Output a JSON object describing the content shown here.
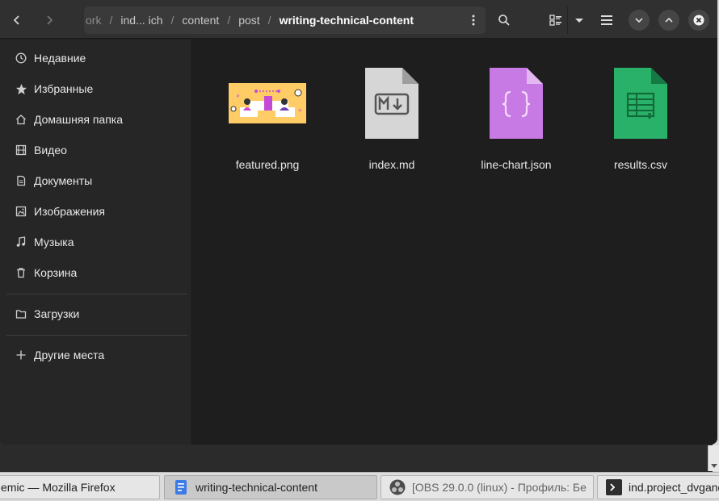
{
  "window": {
    "path": {
      "crumbs": [
        {
          "label": "ork",
          "truncated": true
        },
        {
          "label": "ind... ich"
        },
        {
          "label": "content"
        },
        {
          "label": "post"
        },
        {
          "label": "writing-technical-content",
          "current": true
        }
      ],
      "separator": "/"
    },
    "header_icons": [
      "back-icon",
      "forward-icon",
      "path-menu-icon",
      "search-icon",
      "view-toggle-icon",
      "view-dropdown-icon",
      "main-menu-icon",
      "minimize-icon",
      "maximize-icon",
      "close-icon"
    ]
  },
  "sidebar": {
    "items": [
      {
        "label": "Недавние",
        "icon": "clock-icon"
      },
      {
        "label": "Избранные",
        "icon": "star-icon"
      },
      {
        "label": "Домашняя папка",
        "icon": "home-icon"
      },
      {
        "label": "Видео",
        "icon": "video-icon"
      },
      {
        "label": "Документы",
        "icon": "document-icon"
      },
      {
        "label": "Изображения",
        "icon": "image-icon"
      },
      {
        "label": "Музыка",
        "icon": "music-icon"
      },
      {
        "label": "Корзина",
        "icon": "trash-icon"
      },
      {
        "label": "Загрузки",
        "icon": "folder-icon"
      },
      {
        "label": "Другие места",
        "icon": "plus-icon"
      }
    ]
  },
  "files": [
    {
      "name": "featured.png",
      "type": "image"
    },
    {
      "name": "index.md",
      "type": "markdown"
    },
    {
      "name": "line-chart.json",
      "type": "json"
    },
    {
      "name": "results.csv",
      "type": "spreadsheet"
    }
  ],
  "taskbar": {
    "tasks": [
      {
        "label": "emic — Mozilla Firefox",
        "icon": ""
      },
      {
        "label": "writing-technical-content",
        "icon": "files-icon",
        "active": true
      },
      {
        "label": "[OBS 29.0.0 (linux) - Профиль: Бе",
        "icon": "obs-icon"
      },
      {
        "label": "ind.project_dvgand",
        "icon": "terminal-icon"
      }
    ]
  },
  "colors": {
    "accent_json": "#c77ae3",
    "accent_csv": "#2ab169",
    "accent_png": "#ffcc66",
    "window_bg": "#1e1e1e",
    "headerbar": "#303030"
  }
}
